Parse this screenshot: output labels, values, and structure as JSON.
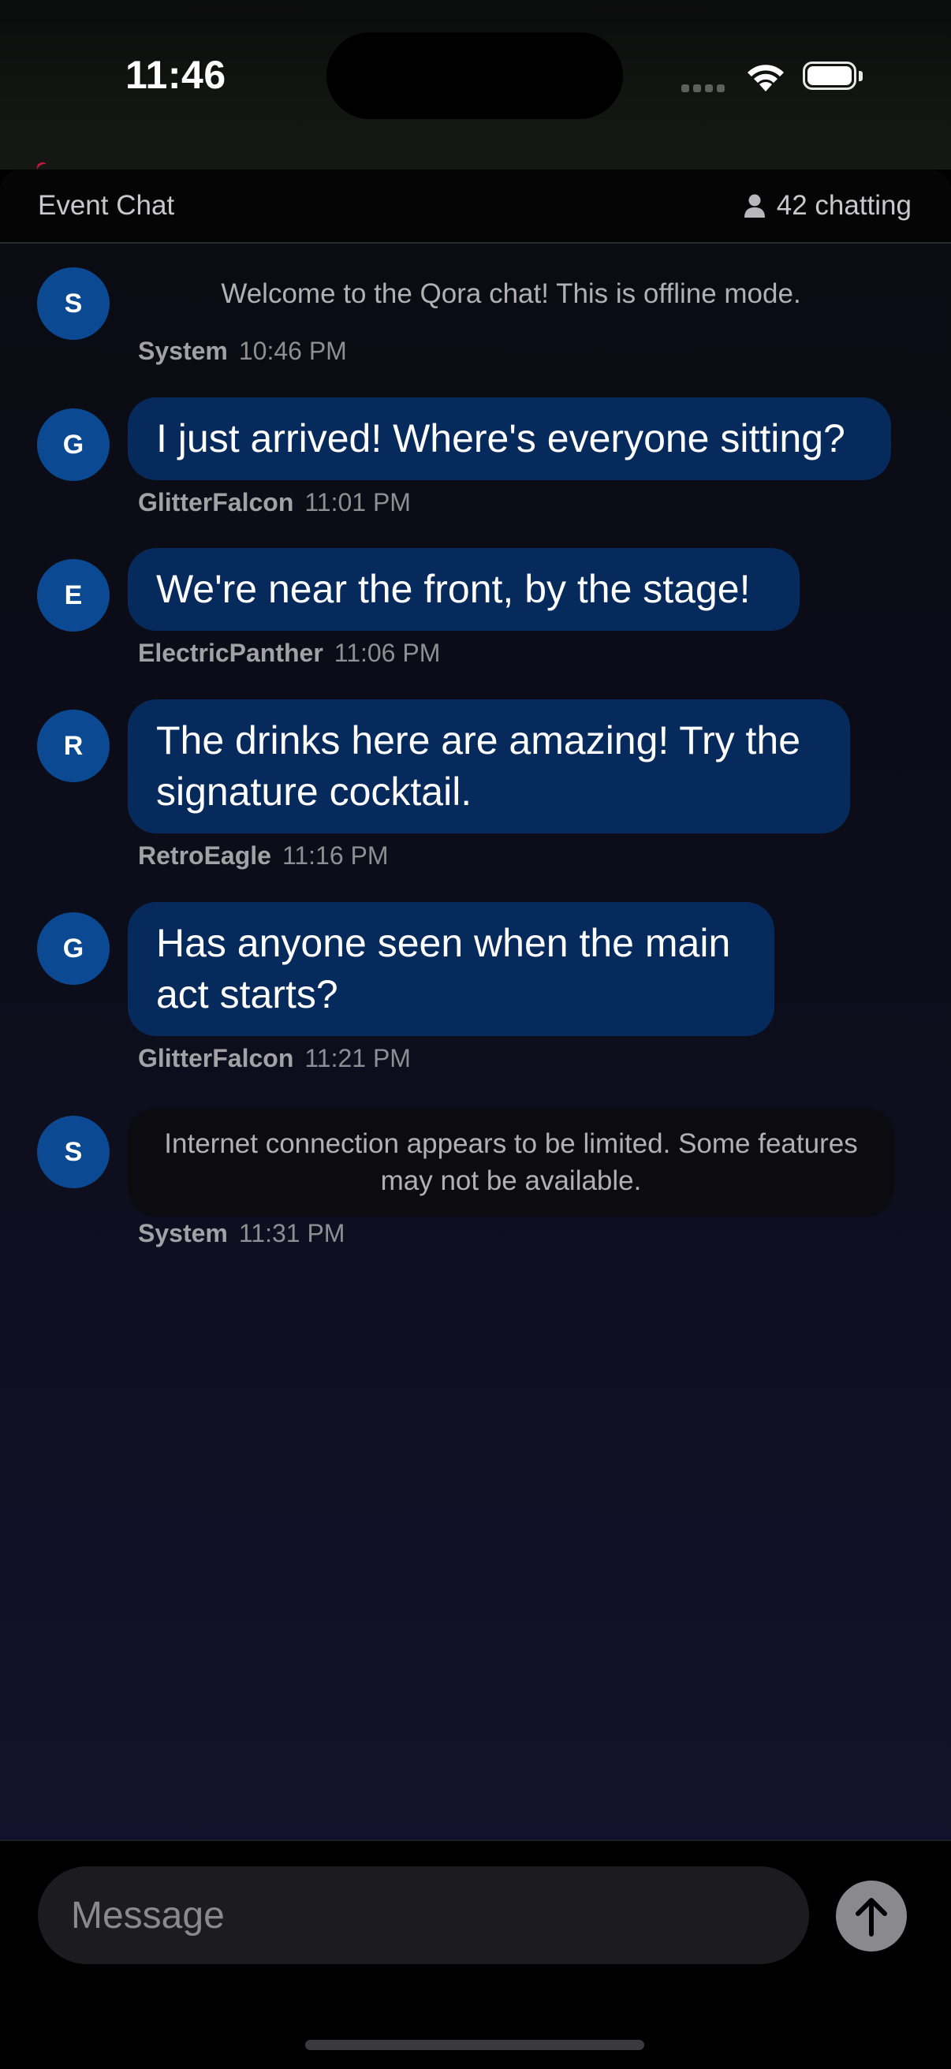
{
  "status_bar": {
    "time": "11:46"
  },
  "header": {
    "title": "Event Chat",
    "chatting": "42 chatting"
  },
  "messages": [
    {
      "initial": "S",
      "type": "system",
      "text": "Welcome to the Qora chat! This is offline mode.",
      "user": "System",
      "time": "10:46 PM"
    },
    {
      "initial": "G",
      "type": "user",
      "text": "I just arrived! Where's everyone sitting?",
      "user": "GlitterFalcon",
      "time": "11:01 PM"
    },
    {
      "initial": "E",
      "type": "user",
      "text": "We're near the front, by the stage!",
      "user": "ElectricPanther",
      "time": "11:06 PM"
    },
    {
      "initial": "R",
      "type": "user",
      "text": "The drinks here are amazing! Try the signature cocktail.",
      "user": "RetroEagle",
      "time": "11:16 PM"
    },
    {
      "initial": "G",
      "type": "user",
      "text": "Has anyone seen when the main act starts?",
      "user": "GlitterFalcon",
      "time": "11:21 PM"
    },
    {
      "initial": "S",
      "type": "system",
      "text": "Internet connection appears to be limited. Some features may not be available.",
      "user": "System",
      "time": "11:31 PM"
    }
  ],
  "composer": {
    "placeholder": "Message",
    "send_icon": "arrow-up-icon"
  },
  "colors": {
    "bubble": "#062a5c",
    "avatar": "#0b4a93",
    "background": "#0c0d1a"
  }
}
